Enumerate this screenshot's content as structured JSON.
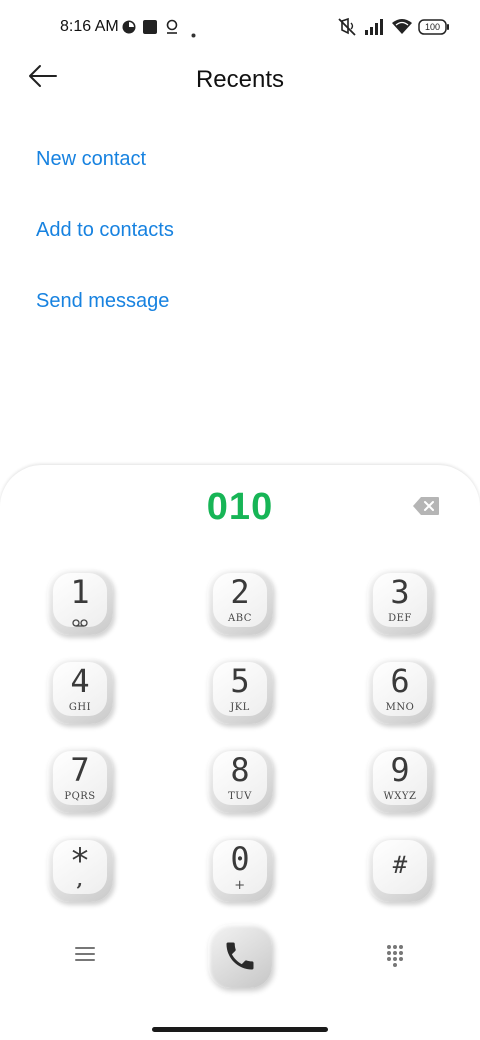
{
  "status_bar": {
    "time": "8:16 AM",
    "battery": "100",
    "icons": [
      "data-saver-icon",
      "square-icon",
      "location-icon",
      "dot-icon",
      "mute-icon",
      "signal-icon",
      "wifi-icon",
      "battery-icon"
    ]
  },
  "header": {
    "title": "Recents",
    "back_icon": "arrow-left-icon"
  },
  "actions": {
    "new_contact": "New contact",
    "add_to_contacts": "Add to contacts",
    "send_message": "Send message"
  },
  "dialer": {
    "number": "010",
    "keys": [
      {
        "digit": "1",
        "letters": ""
      },
      {
        "digit": "2",
        "letters": "ABC"
      },
      {
        "digit": "3",
        "letters": "DEF"
      },
      {
        "digit": "4",
        "letters": "GHI"
      },
      {
        "digit": "5",
        "letters": "JKL"
      },
      {
        "digit": "6",
        "letters": "MNO"
      },
      {
        "digit": "7",
        "letters": "PQRS"
      },
      {
        "digit": "8",
        "letters": "TUV"
      },
      {
        "digit": "9",
        "letters": "WXYZ"
      },
      {
        "digit": "*",
        "letters": ","
      },
      {
        "digit": "0",
        "letters": "+"
      },
      {
        "digit": "#",
        "letters": ""
      }
    ]
  },
  "bottom_bar": {
    "icons": [
      "menu-icon",
      "phone-icon",
      "keypad-icon"
    ]
  },
  "colors": {
    "accent_link": "#1782e0",
    "dialed_number": "#17b556"
  }
}
